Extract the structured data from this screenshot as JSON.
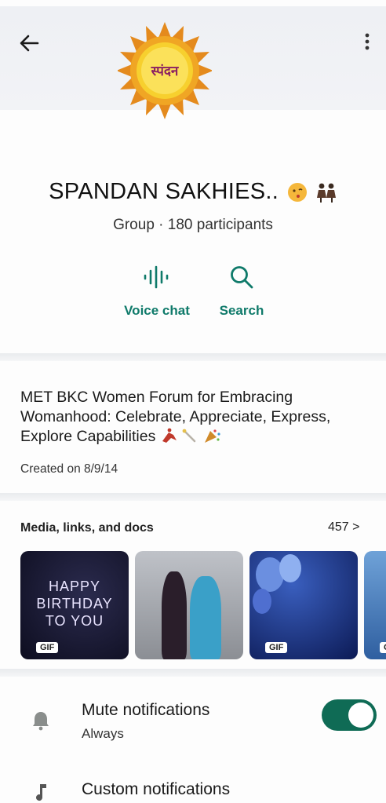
{
  "header": {
    "back_icon": "arrow-left-icon",
    "more_icon": "vertical-dots-icon",
    "logo_text": "स्पंदन"
  },
  "group": {
    "name": "SPANDAN SAKHIES..",
    "subtitle": "Group · 180 participants"
  },
  "actions": [
    {
      "label": "Voice chat",
      "icon": "voice-wave-icon"
    },
    {
      "label": "Search",
      "icon": "search-icon"
    }
  ],
  "description": {
    "text": "MET BKC Women Forum for Embracing Womanhood: Celebrate, Appreciate, Express, Explore Capabilities",
    "created": "Created on 8/9/14"
  },
  "media": {
    "label": "Media, links, and docs",
    "count": "457 >",
    "thumbs": [
      {
        "text": "HAPPY BIRTHDAY TO YOU",
        "badge": "GIF"
      },
      {
        "badge": ""
      },
      {
        "badge": "GIF"
      },
      {
        "badge": "G"
      }
    ]
  },
  "settings": {
    "mute_title": "Mute notifications",
    "mute_value": "Always",
    "mute_enabled": true,
    "custom_title": "Custom notifications"
  },
  "colors": {
    "accent": "#0f7a6a",
    "toggle": "#0f6b55"
  }
}
